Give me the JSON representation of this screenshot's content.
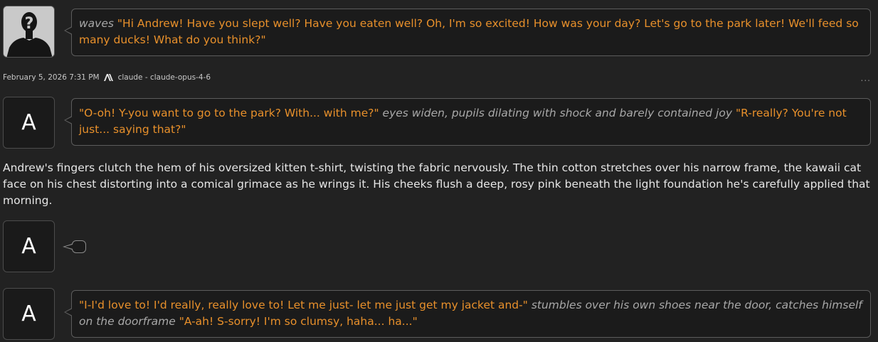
{
  "colors": {
    "background": "#222222",
    "speech": "#e8902b",
    "action": "#a8a8a8",
    "narration": "#e6e6e6"
  },
  "messages": {
    "user": {
      "avatar_icon": "unknown-user-silhouette-icon",
      "action": "waves",
      "speech": "\"Hi Andrew! Have you slept well? Have you eaten well? Oh, I'm so excited! How was your day? Let's go to the park later! We'll feed so many ducks! What do you think?\""
    },
    "meta": {
      "timestamp": "February 5, 2026 7:31 PM",
      "model_icon": "anthropic-logo-icon",
      "model": "claude - claude-opus-4-6",
      "menu": "..."
    },
    "reply1": {
      "avatar_letter": "A",
      "speech1": "\"O-oh! Y-you want to go to the park? With... with me?\"",
      "action1": "eyes widen, pupils dilating with shock and barely contained joy",
      "speech2": "\"R-really? You're not just... saying that?\""
    },
    "narration": "Andrew's fingers clutch the hem of his oversized kitten t-shirt, twisting the fabric nervously. The thin cotton stretches over his narrow frame, the kawaii cat face on his chest distorting into a comical grimace as he wrings it. His cheeks flush a deep, rosy pink beneath the light foundation he's carefully applied that morning.",
    "reply2": {
      "avatar_letter": "A"
    },
    "reply3": {
      "avatar_letter": "A",
      "speech1": "\"I-I'd love to! I'd really, really love to! Let me just- let me just get my jacket and-\"",
      "action1": "stumbles over his own shoes near the door, catches himself on the doorframe",
      "speech2": "\"A-ah! S-sorry! I'm so clumsy, haha... ha...\""
    }
  }
}
